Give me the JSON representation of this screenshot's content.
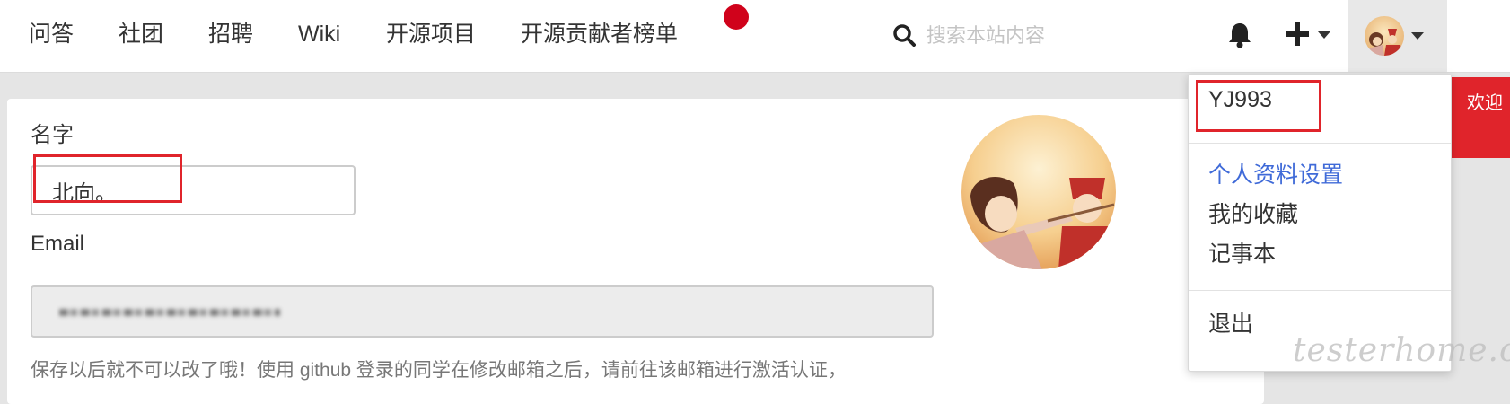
{
  "nav": {
    "items": [
      "问答",
      "社团",
      "招聘",
      "Wiki",
      "开源项目",
      "开源贡献者榜单"
    ],
    "search_placeholder": "搜索本站内容",
    "icons": [
      "search-icon",
      "bell-icon",
      "plus-icon",
      "caret-down-icon"
    ]
  },
  "form": {
    "name_label": "名字",
    "name_value": "北向。",
    "email_label": "Email",
    "email_value": "",
    "help_text": "保存以后就不可以改了哦！使用 github 登录的同学在修改邮箱之后，请前往该邮箱进行激活认证，"
  },
  "dropdown": {
    "username": "YJ993",
    "items": [
      "个人资料设置",
      "我的收藏",
      "记事本"
    ],
    "logout": "退出"
  },
  "ribbon": {
    "text": "欢迎"
  },
  "watermark": {
    "text": "testerhome.com"
  },
  "colors": {
    "accent_link": "#3f6ad8",
    "highlight_red": "#e0242b",
    "notice_dot": "#d0021b"
  }
}
